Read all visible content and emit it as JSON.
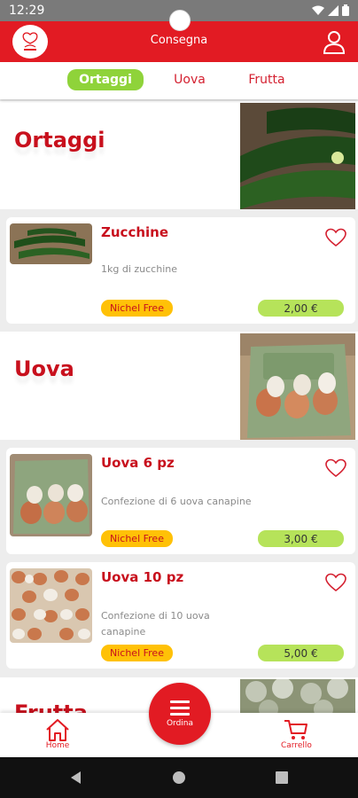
{
  "status_bar": {
    "time": "12:29"
  },
  "app_bar": {
    "title": "Consegna"
  },
  "tabs": [
    {
      "label": "Ortaggi",
      "active": true
    },
    {
      "label": "Uova",
      "active": false
    },
    {
      "label": "Frutta",
      "active": false
    }
  ],
  "sections": [
    {
      "title": "Ortaggi",
      "products": [
        {
          "name": "Zucchine",
          "description": "1kg di zucchine",
          "tag": "Nichel Free",
          "price": "2,00 €"
        }
      ]
    },
    {
      "title": "Uova",
      "products": [
        {
          "name": "Uova 6 pz",
          "description": "Confezione di 6 uova canapine",
          "tag": "Nichel Free",
          "price": "3,00 €"
        },
        {
          "name": "Uova 10 pz",
          "description": "Confezione di 10 uova canapine",
          "tag": "Nichel Free",
          "price": "5,00 €"
        }
      ]
    },
    {
      "title": "Frutta"
    }
  ],
  "bottom_nav": {
    "home_label": "Home",
    "order_label": "Ordina",
    "cart_label": "Carrello"
  },
  "colors": {
    "primary": "#e21b23",
    "accent_green": "#8fd33a",
    "tag_yellow": "#ffc107",
    "price_green": "#b6e35a"
  }
}
